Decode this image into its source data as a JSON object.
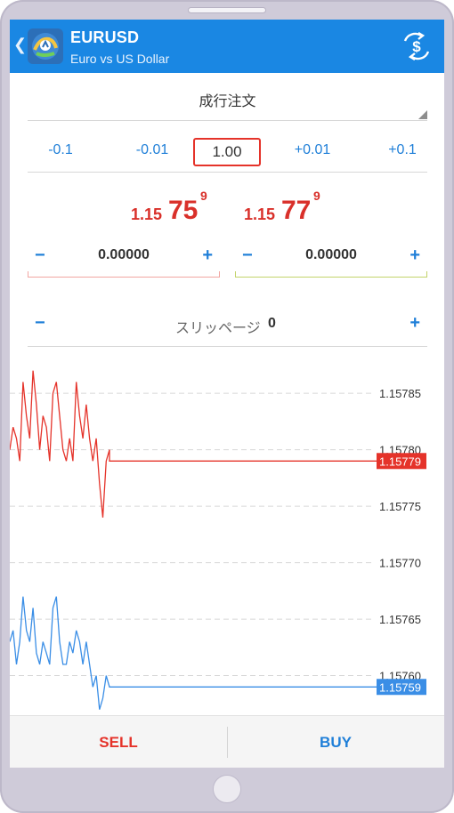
{
  "header": {
    "symbol": "EURUSD",
    "description": "Euro vs US Dollar",
    "back_icon": "chevron-left-icon",
    "logo_icon": "metatrader-logo-icon",
    "exchange_icon": "currency-exchange-icon"
  },
  "order_type": {
    "label": "成行注文"
  },
  "volume": {
    "steps": [
      "-0.1",
      "-0.01",
      "+0.01",
      "+0.1"
    ],
    "value": "1.00"
  },
  "prices": {
    "sell": {
      "prefix": "1.15",
      "big": "75",
      "sup": "9"
    },
    "buy": {
      "prefix": "1.15",
      "big": "77",
      "sup": "9"
    }
  },
  "stop_loss": {
    "value": "0.00000",
    "minus": "−",
    "plus": "+"
  },
  "take_profit": {
    "value": "0.00000",
    "minus": "−",
    "plus": "+"
  },
  "slippage": {
    "label": "スリッページ",
    "value": "0",
    "minus": "−",
    "plus": "+"
  },
  "chart_data": {
    "type": "line",
    "y_ticks": [
      "1.15785",
      "1.15780",
      "1.15775",
      "1.15770",
      "1.15765",
      "1.15760"
    ],
    "ylim": [
      1.157565,
      1.15788
    ],
    "grid": true,
    "series": [
      {
        "color": "#e5332a",
        "current_label": "1.15779",
        "values": [
          1.1578,
          1.15782,
          1.15781,
          1.15779,
          1.15786,
          1.15783,
          1.15781,
          1.15787,
          1.15784,
          1.1578,
          1.15783,
          1.15782,
          1.15779,
          1.15785,
          1.15786,
          1.15783,
          1.1578,
          1.15779,
          1.15781,
          1.15779,
          1.15786,
          1.15783,
          1.15781,
          1.15784,
          1.15781,
          1.15779,
          1.15781,
          1.15777,
          1.15774,
          1.15779,
          1.1578,
          1.15779,
          1.15779,
          1.15779,
          1.15779,
          1.15779,
          1.15779
        ]
      },
      {
        "color": "#3a8ee6",
        "current_label": "1.15759",
        "values": [
          1.15763,
          1.15764,
          1.15761,
          1.15763,
          1.15767,
          1.15764,
          1.15763,
          1.15766,
          1.15762,
          1.15761,
          1.15763,
          1.15762,
          1.15761,
          1.15766,
          1.15767,
          1.15763,
          1.15761,
          1.15761,
          1.15763,
          1.15762,
          1.15764,
          1.15763,
          1.15761,
          1.15763,
          1.15761,
          1.15759,
          1.1576,
          1.15757,
          1.15758,
          1.1576,
          1.15759,
          1.15759,
          1.15759,
          1.15759,
          1.15759,
          1.15759,
          1.15759
        ]
      }
    ]
  },
  "actions": {
    "sell": "SELL",
    "buy": "BUY"
  }
}
